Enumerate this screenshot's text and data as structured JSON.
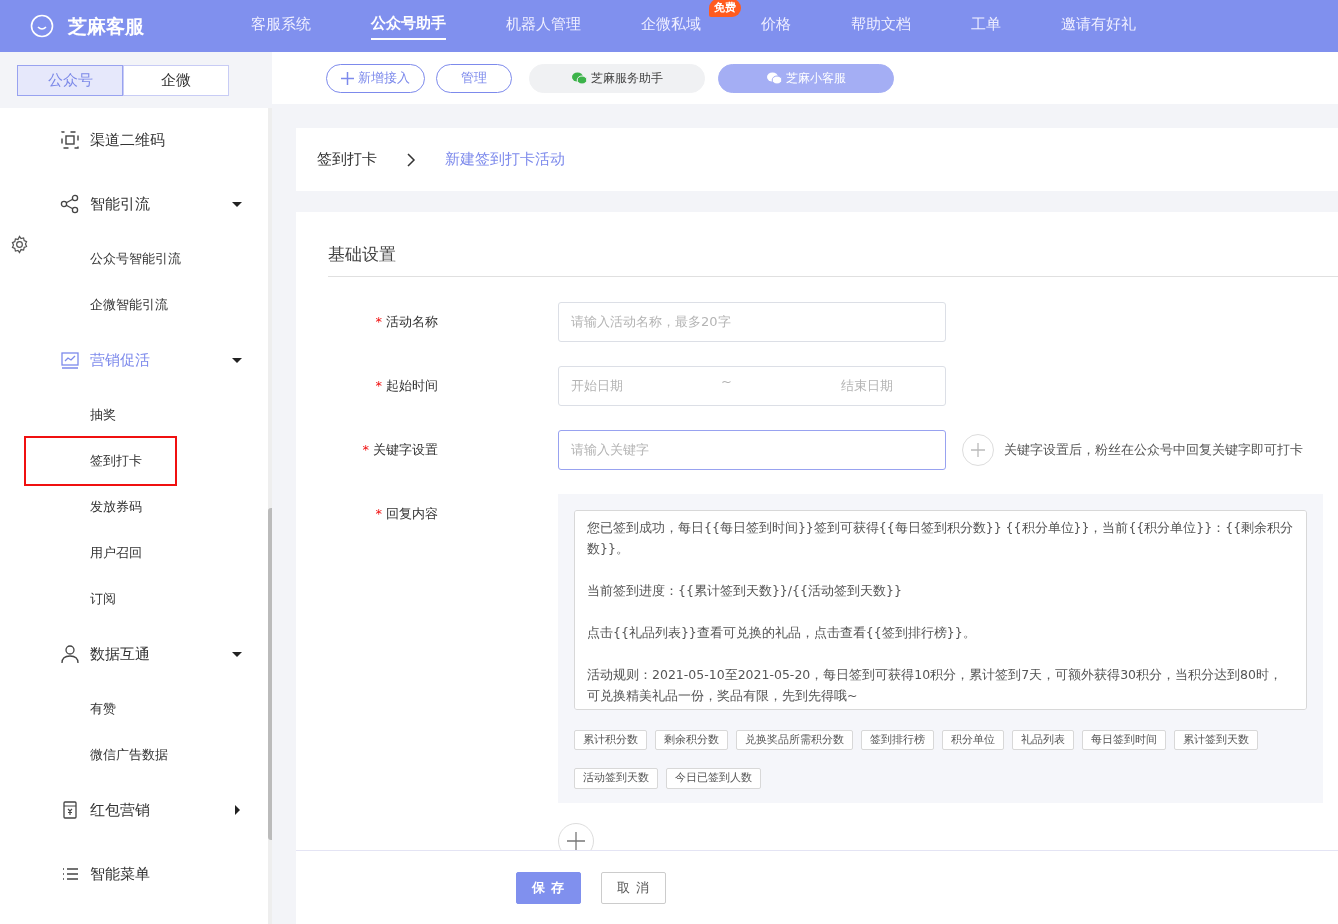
{
  "brand": {
    "name": "芝麻客服"
  },
  "nav": [
    {
      "label": "客服系统",
      "selected": false
    },
    {
      "label": "公众号助手",
      "selected": true
    },
    {
      "label": "机器人管理",
      "selected": false
    },
    {
      "label": "企微私域",
      "selected": false,
      "badge": "免费"
    },
    {
      "label": "价格",
      "selected": false
    },
    {
      "label": "帮助文档",
      "selected": false
    },
    {
      "label": "工单",
      "selected": false
    },
    {
      "label": "邀请有好礼",
      "selected": false
    }
  ],
  "account_tabs": [
    {
      "label": "公众号",
      "selected": true
    },
    {
      "label": "企微",
      "selected": false
    }
  ],
  "sidebar": {
    "items": [
      {
        "label": "渠道二维码",
        "selected": false
      },
      {
        "label": "智能引流",
        "selected": false,
        "expanded": true,
        "children": [
          {
            "label": "公众号智能引流",
            "selected": false,
            "outlined": false
          },
          {
            "label": "企微智能引流",
            "selected": false,
            "outlined": false
          }
        ]
      },
      {
        "label": "营销促活",
        "selected": true,
        "expanded": true,
        "children": [
          {
            "label": "抽奖",
            "selected": false,
            "outlined": false
          },
          {
            "label": "签到打卡",
            "selected": false,
            "outlined": true
          },
          {
            "label": "发放券码",
            "selected": false,
            "outlined": false
          },
          {
            "label": "用户召回",
            "selected": false,
            "outlined": false
          },
          {
            "label": "订阅",
            "selected": false,
            "outlined": false
          }
        ]
      },
      {
        "label": "数据互通",
        "selected": false,
        "expanded": true,
        "children": [
          {
            "label": "有赞",
            "selected": false,
            "outlined": false
          },
          {
            "label": "微信广告数据",
            "selected": false,
            "outlined": false
          }
        ]
      },
      {
        "label": "红包营销",
        "selected": false,
        "expanded": false
      },
      {
        "label": "智能菜单",
        "selected": false
      }
    ]
  },
  "toolbar": {
    "buttons": [
      {
        "kind": "add",
        "label": "新增接入"
      },
      {
        "kind": "outline",
        "label": "管理"
      }
    ],
    "accounts": [
      {
        "label": "芝麻服务助手",
        "selected": false
      },
      {
        "label": "芝麻小客服",
        "selected": true
      }
    ]
  },
  "breadcrumb": {
    "root": "签到打卡",
    "current": "新建签到打卡活动"
  },
  "form": {
    "section_title": "基础设置",
    "fields": [
      {
        "kind": "text",
        "label": "活动名称",
        "required_mark": "*",
        "focused": false,
        "placeholder": "请输入活动名称，最多20字"
      },
      {
        "kind": "daterange",
        "label": "起始时间",
        "required_mark": "*",
        "focused": false,
        "start_placeholder": "开始日期",
        "separator": "~",
        "end_placeholder": "结束日期"
      },
      {
        "kind": "keyword",
        "label": "关键字设置",
        "required_mark": "*",
        "focused": true,
        "placeholder": "请输入关键字",
        "hint": "关键字设置后，粉丝在公众号中回复关键字即可打卡"
      },
      {
        "kind": "reply",
        "label": "回复内容",
        "required_mark": "*",
        "paragraphs": [
          "您已签到成功，每日{{每日签到时间}}签到可获得{{每日签到积分数}} {{积分单位}}，当前{{积分单位}}：{{剩余积分数}}。",
          "当前签到进度：{{累计签到天数}}/{{活动签到天数}}",
          "点击{{礼品列表}}查看可兑换的礼品，点击查看{{签到排行榜}}。",
          "活动规则：2021-05-10至2021-05-20，每日签到可获得10积分，累计签到7天，可额外获得30积分，当积分达到80时，可兑换精美礼品一份，奖品有限，先到先得哦~"
        ],
        "tags": [
          "累计积分数",
          "剩余积分数",
          "兑换奖品所需积分数",
          "签到排行榜",
          "积分单位",
          "礼品列表",
          "每日签到时间",
          "累计签到天数",
          "活动签到天数",
          "今日已签到人数"
        ]
      }
    ]
  },
  "footer_buttons": [
    {
      "kind": "primary",
      "label": "保 存"
    },
    {
      "kind": "default",
      "label": "取 消"
    }
  ]
}
